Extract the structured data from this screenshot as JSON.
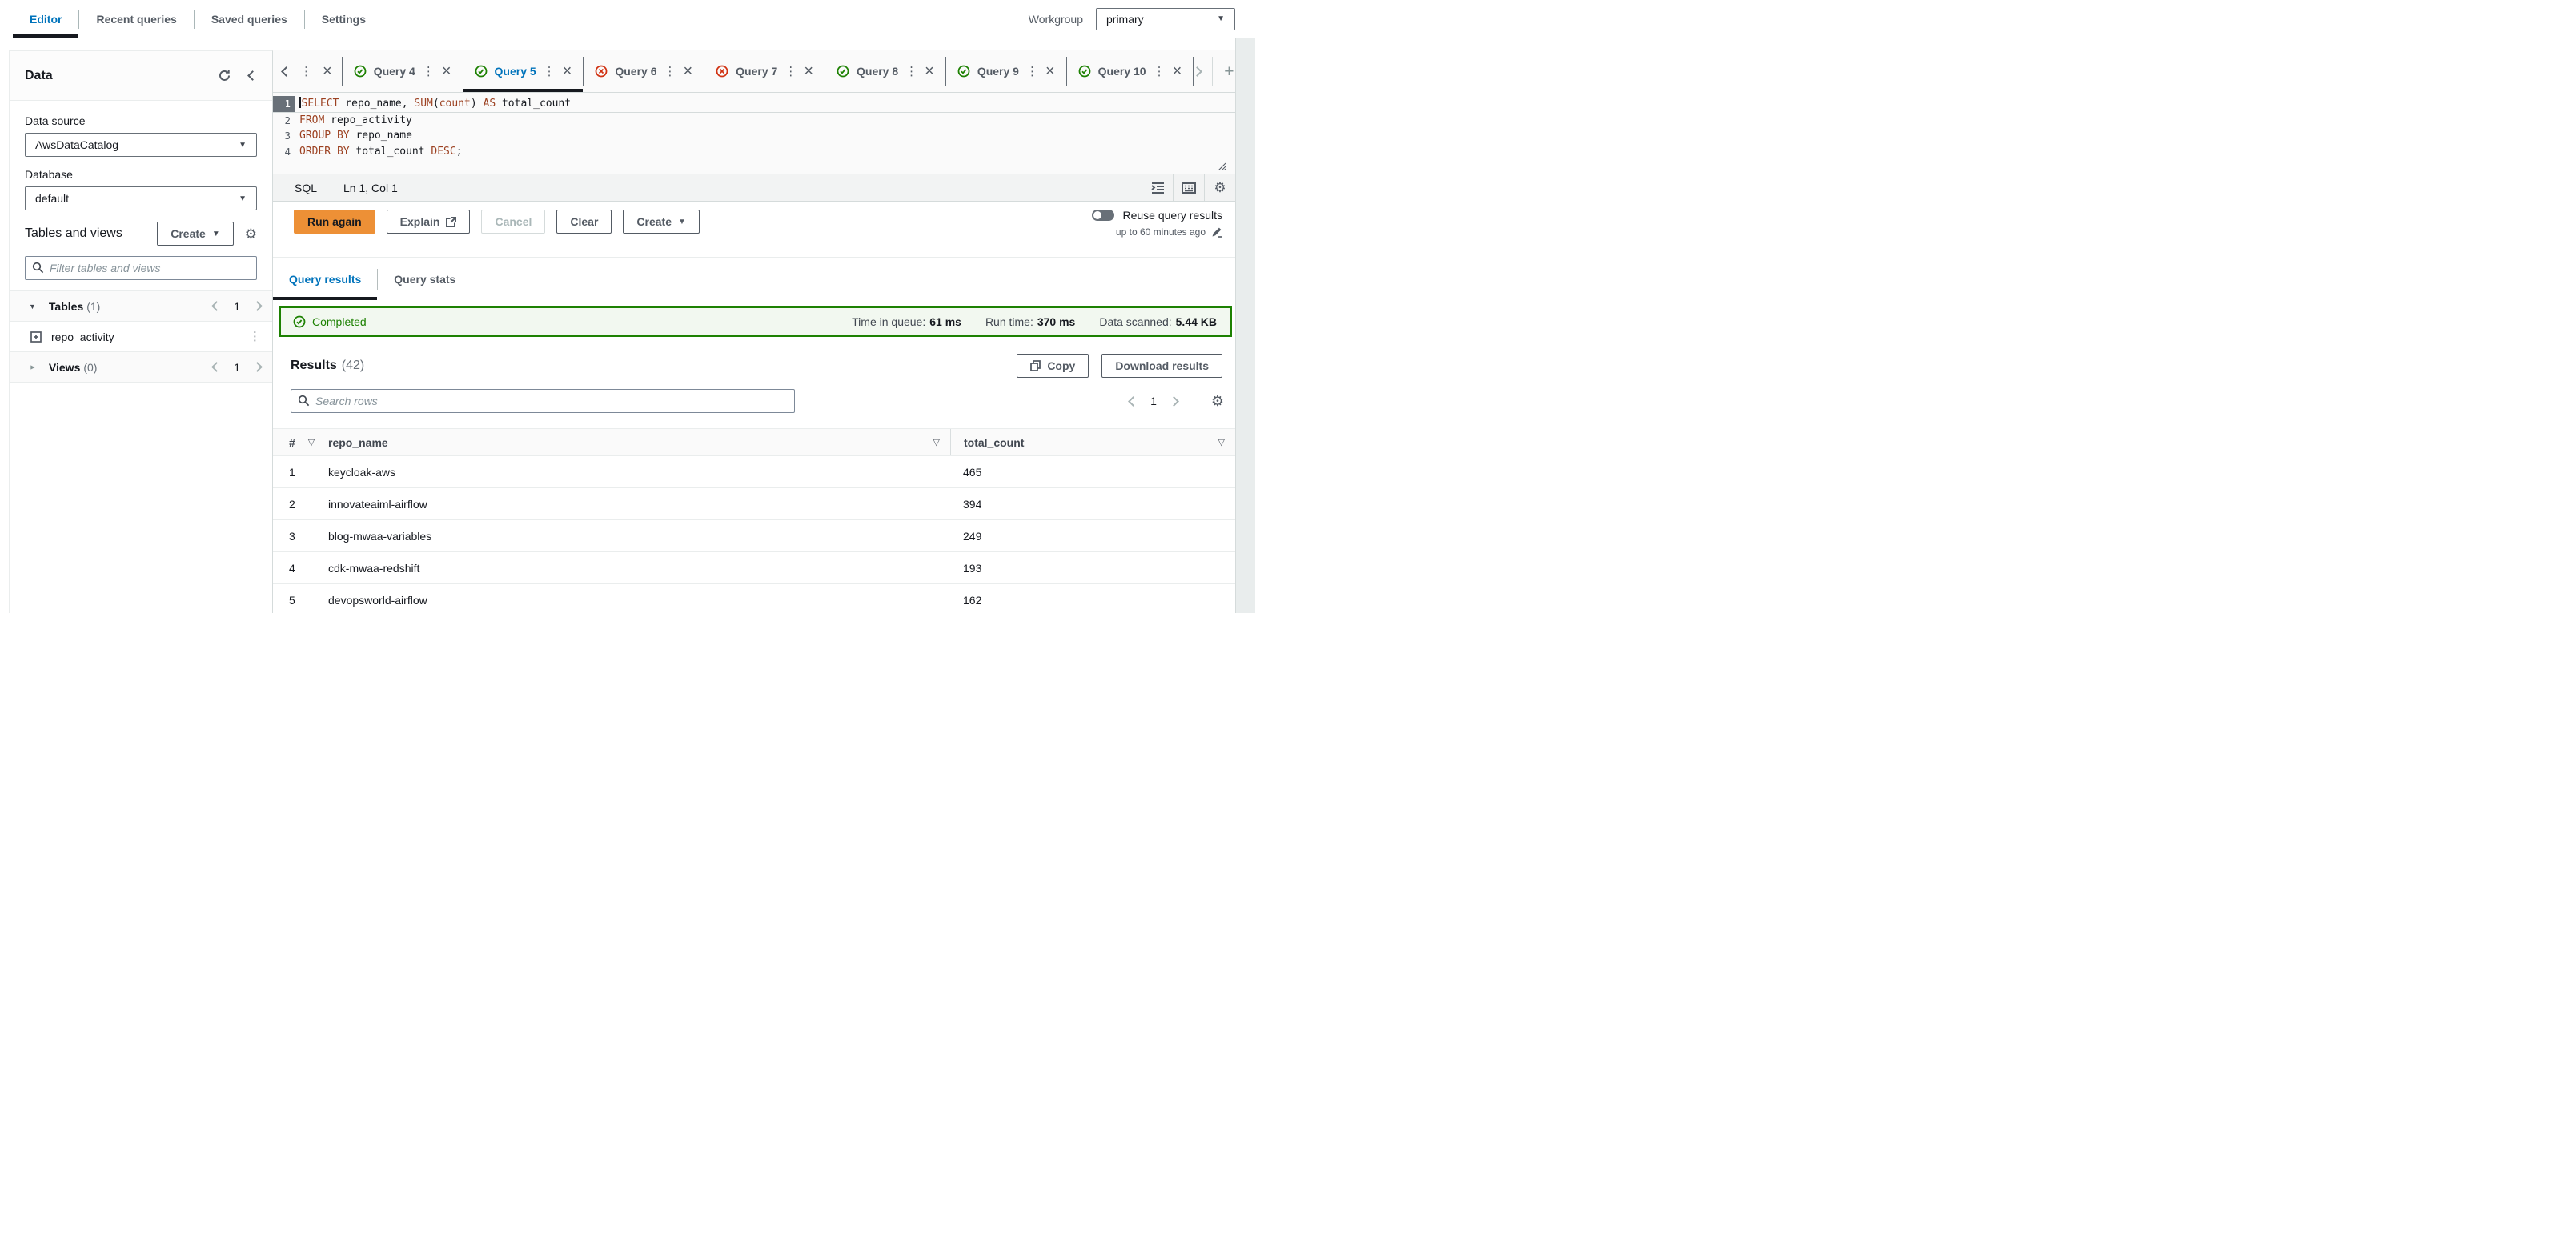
{
  "topnav": {
    "tabs": [
      {
        "label": "Editor",
        "active": true
      },
      {
        "label": "Recent queries",
        "active": false
      },
      {
        "label": "Saved queries",
        "active": false
      },
      {
        "label": "Settings",
        "active": false
      }
    ],
    "workgroup_label": "Workgroup",
    "workgroup_value": "primary"
  },
  "sidebar": {
    "title": "Data",
    "data_source_label": "Data source",
    "data_source_value": "AwsDataCatalog",
    "database_label": "Database",
    "database_value": "default",
    "tables_views_title": "Tables and views",
    "create_button": "Create",
    "filter_placeholder": "Filter tables and views",
    "tables_section": {
      "label": "Tables",
      "count": "(1)",
      "page": "1"
    },
    "table_items": [
      {
        "name": "repo_activity"
      }
    ],
    "views_section": {
      "label": "Views",
      "count": "(0)",
      "page": "1"
    }
  },
  "editor": {
    "tabs": [
      {
        "label": "Query 4",
        "status": "success",
        "active": false
      },
      {
        "label": "Query 5",
        "status": "success",
        "active": true
      },
      {
        "label": "Query 6",
        "status": "error",
        "active": false
      },
      {
        "label": "Query 7",
        "status": "error",
        "active": false
      },
      {
        "label": "Query 8",
        "status": "success",
        "active": false
      },
      {
        "label": "Query 9",
        "status": "success",
        "active": false
      },
      {
        "label": "Query 10",
        "status": "success",
        "active": false
      }
    ],
    "code": [
      [
        {
          "t": "SELECT",
          "kw": true
        },
        {
          "t": " repo_name, "
        },
        {
          "t": "SUM",
          "kw": true
        },
        {
          "t": "("
        },
        {
          "t": "count",
          "kw": true
        },
        {
          "t": ") "
        },
        {
          "t": "AS",
          "kw": true
        },
        {
          "t": " total_count"
        }
      ],
      [
        {
          "t": "FROM",
          "kw": true
        },
        {
          "t": " repo_activity"
        }
      ],
      [
        {
          "t": "GROUP BY",
          "kw": true
        },
        {
          "t": " repo_name"
        }
      ],
      [
        {
          "t": "ORDER BY",
          "kw": true
        },
        {
          "t": " total_count "
        },
        {
          "t": "DESC",
          "kw": true
        },
        {
          "t": ";"
        }
      ]
    ],
    "status_lang": "SQL",
    "status_cursor": "Ln 1, Col 1"
  },
  "actions": {
    "run": "Run again",
    "explain": "Explain",
    "cancel": "Cancel",
    "clear": "Clear",
    "create": "Create",
    "reuse_label": "Reuse query results",
    "reuse_sub": "up to 60 minutes ago"
  },
  "results": {
    "tabs": [
      {
        "label": "Query results",
        "active": true
      },
      {
        "label": "Query stats",
        "active": false
      }
    ],
    "banner": {
      "status": "Completed",
      "metrics": [
        {
          "label": "Time in queue:",
          "value": "61 ms"
        },
        {
          "label": "Run time:",
          "value": "370 ms"
        },
        {
          "label": "Data scanned:",
          "value": "5.44 KB"
        }
      ]
    },
    "title": "Results",
    "count": "(42)",
    "copy_button": "Copy",
    "download_button": "Download results",
    "search_placeholder": "Search rows",
    "page": "1",
    "table": {
      "headers": [
        "#",
        "repo_name",
        "total_count"
      ],
      "rows": [
        [
          "1",
          "keycloak-aws",
          "465"
        ],
        [
          "2",
          "innovateaiml-airflow",
          "394"
        ],
        [
          "3",
          "blog-mwaa-variables",
          "249"
        ],
        [
          "4",
          "cdk-mwaa-redshift",
          "193"
        ],
        [
          "5",
          "devopsworld-airflow",
          "162"
        ]
      ]
    }
  },
  "colors": {
    "accent": "#0073bb",
    "run_orange": "#ed9036",
    "success_green": "#1d8102",
    "error_red": "#d13212"
  }
}
